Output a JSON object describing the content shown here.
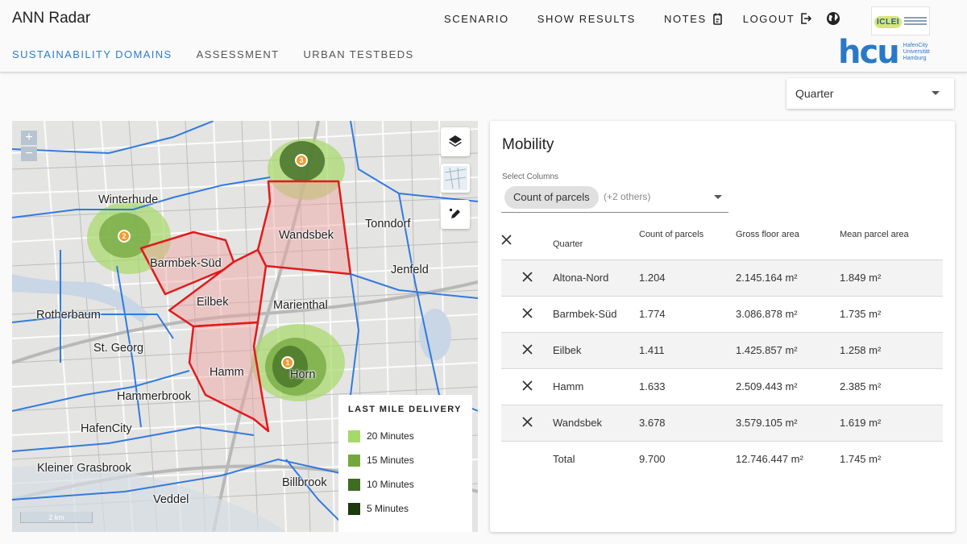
{
  "app": {
    "title": "ANN Radar"
  },
  "topnav": {
    "scenario": "SCENARIO",
    "show_results": "SHOW RESULTS",
    "notes": "NOTES",
    "logout": "LOGOUT"
  },
  "subnav": {
    "sustainability": "SUSTAINABILITY DOMAINS",
    "assessment": "ASSESSMENT",
    "urban_testbeds": "URBAN TESTBEDS"
  },
  "logos": {
    "iclei": "ICLEI",
    "hcu_mark": "hcu",
    "hcu_line1": "HafenCity",
    "hcu_line2": "Universität",
    "hcu_line3": "Hamburg"
  },
  "quarter_select": {
    "value": "Quarter"
  },
  "map": {
    "labels": {
      "winterhude": "Winterhude",
      "barmbek_sued": "Barmbek-Süd",
      "wandsbek": "Wandsbek",
      "tonndorf": "Tonndorf",
      "jenfeld": "Jenfeld",
      "eilbek": "Eilbek",
      "marienthal": "Marienthal",
      "rotherbaum": "Rotherbaum",
      "st_georg": "St. Georg",
      "hamm": "Hamm",
      "horn": "Horn",
      "hammerbrook": "Hammerbrook",
      "hafencity": "HafenCity",
      "kleiner_grasbrook": "Kleiner Grasbrook",
      "billbrook": "Billbrook",
      "veddel": "Veddel"
    },
    "markers": [
      "1",
      "2",
      "3"
    ],
    "zoom_in": "+",
    "zoom_out": "−",
    "scale": "2 km",
    "legend": {
      "title": "LAST MILE DELIVERY",
      "items": [
        {
          "label": "20 Minutes",
          "color": "#a6d96a"
        },
        {
          "label": "15 Minutes",
          "color": "#74a83f"
        },
        {
          "label": "10 Minutes",
          "color": "#3f6b22"
        },
        {
          "label": "5 Minutes",
          "color": "#1c3a0d"
        }
      ]
    }
  },
  "panel": {
    "title": "Mobility",
    "select_label": "Select Columns",
    "chip": "Count of parcels",
    "others": "(+2 others)",
    "columns": [
      "Quarter",
      "Count of parcels",
      "Gross floor area",
      "Mean parcel area"
    ],
    "rows": [
      {
        "quarter": "Altona-Nord",
        "count": "1.204",
        "gfa": "2.145.164 m²",
        "mean": "1.849 m²"
      },
      {
        "quarter": "Barmbek-Süd",
        "count": "1.774",
        "gfa": "3.086.878 m²",
        "mean": "1.735 m²"
      },
      {
        "quarter": "Eilbek",
        "count": "1.411",
        "gfa": "1.425.857 m²",
        "mean": "1.258 m²"
      },
      {
        "quarter": "Hamm",
        "count": "1.633",
        "gfa": "2.509.443 m²",
        "mean": "2.385 m²"
      },
      {
        "quarter": "Wandsbek",
        "count": "3.678",
        "gfa": "3.579.105 m²",
        "mean": "1.619 m²"
      }
    ],
    "total": {
      "label": "Total",
      "count": "9.700",
      "gfa": "12.746.447 m²",
      "mean": "1.745 m²"
    }
  }
}
